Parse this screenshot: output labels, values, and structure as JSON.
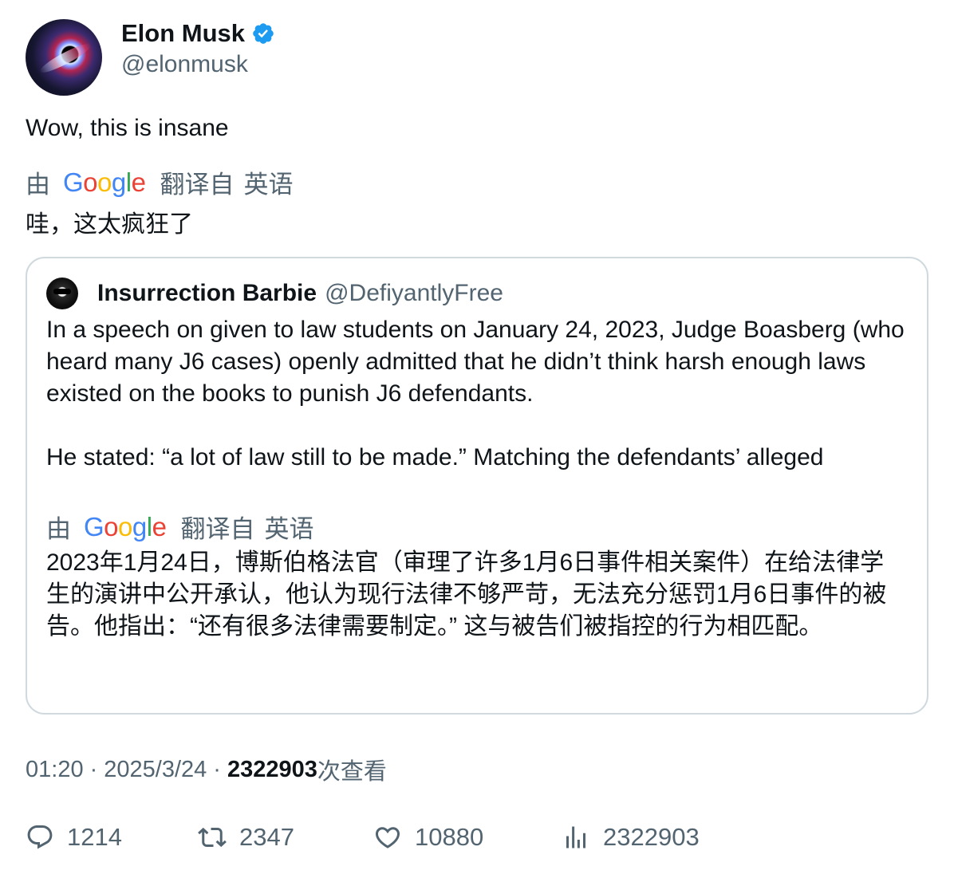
{
  "author": {
    "display_name": "Elon Musk",
    "handle": "@elonmusk",
    "verified_color": "#1d9bf0"
  },
  "tweet": {
    "text": "Wow, this is insane",
    "translation": {
      "by_label": "由",
      "google_text": "Google",
      "from_label": "翻译自",
      "language": "英语",
      "text": "哇，这太疯狂了"
    }
  },
  "quoted_tweet": {
    "display_name": "Insurrection Barbie",
    "handle": "@DefiyantlyFree",
    "paragraph_1": "In a speech on given to law students on January 24, 2023, Judge Boasberg (who heard many J6 cases) openly admitted that he didn’t think harsh enough laws existed on the books to punish J6 defendants.",
    "paragraph_2": "He stated: “a lot of law still to be made.” Matching the defendants’ alleged",
    "translation": {
      "by_label": "由",
      "google_text": "Google",
      "from_label": "翻译自",
      "language": "英语",
      "text": "2023年1月24日，博斯伯格法官（审理了许多1月6日事件相关案件）在给法律学生的演讲中公开承认，他认为现行法律不够严苛，无法充分惩罚1月6日事件的被告。他指出：“还有很多法律需要制定。” 这与被告们被指控的行为相匹配。"
    }
  },
  "meta": {
    "time": "01:20",
    "separator": "·",
    "date": "2025/3/24",
    "views_count": "2322903",
    "views_label": "次查看"
  },
  "actions": {
    "replies": "1214",
    "retweets": "2347",
    "likes": "10880",
    "views": "2322903"
  },
  "colors": {
    "text_primary": "#0f1419",
    "text_secondary": "#536471",
    "border": "#cfd9de"
  }
}
